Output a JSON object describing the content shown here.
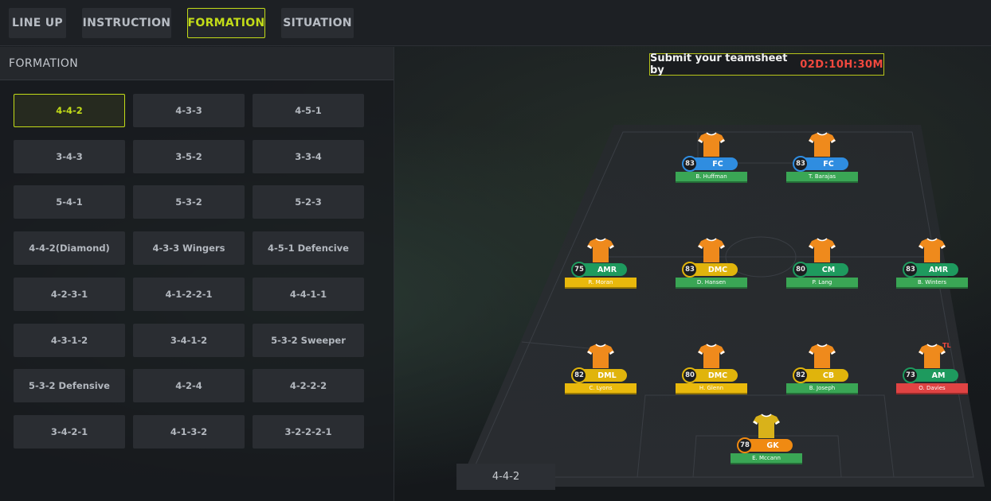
{
  "tabs": [
    {
      "label": "LINE UP",
      "active": false
    },
    {
      "label": "INSTRUCTION",
      "active": false
    },
    {
      "label": "FORMATION",
      "active": true
    },
    {
      "label": "SITUATION",
      "active": false
    }
  ],
  "formation_panel": {
    "title": "FORMATION",
    "options": [
      "4-4-2",
      "4-3-3",
      "4-5-1",
      "3-4-3",
      "3-5-2",
      "3-3-4",
      "5-4-1",
      "5-3-2",
      "5-2-3",
      "4-4-2(Diamond)",
      "4-3-3 Wingers",
      "4-5-1 Defencive",
      "4-2-3-1",
      "4-1-2-2-1",
      "4-4-1-1",
      "4-3-1-2",
      "3-4-1-2",
      "5-3-2 Sweeper",
      "5-3-2 Defensive",
      "4-2-4",
      "4-2-2-2",
      "3-4-2-1",
      "4-1-3-2",
      "3-2-2-2-1"
    ],
    "selected": "4-4-2"
  },
  "deadline": {
    "label": "Submit your teamsheet by",
    "countdown": "02D:10H:30M"
  },
  "pitch": {
    "formation_label": "4-4-2",
    "players": [
      {
        "name": "B. Huffman",
        "pos": "FC",
        "rating": "83",
        "bar_color": "#2f8de0",
        "ring_color": "#2f8de0",
        "name_color": "#3aa655",
        "shirt": "orange"
      },
      {
        "name": "T. Barajas",
        "pos": "FC",
        "rating": "83",
        "bar_color": "#2f8de0",
        "ring_color": "#2f8de0",
        "name_color": "#3aa655",
        "shirt": "orange"
      },
      {
        "name": "R. Moran",
        "pos": "AMR",
        "rating": "75",
        "bar_color": "#1e9a5e",
        "ring_color": "#1e9a5e",
        "name_color": "#e9b90c",
        "shirt": "orange"
      },
      {
        "name": "D. Hansen",
        "pos": "DMC",
        "rating": "83",
        "bar_color": "#e0b40c",
        "ring_color": "#e0b40c",
        "name_color": "#3aa655",
        "shirt": "orange"
      },
      {
        "name": "P. Lang",
        "pos": "CM",
        "rating": "80",
        "bar_color": "#1e9a5e",
        "ring_color": "#1e9a5e",
        "name_color": "#3aa655",
        "shirt": "orange"
      },
      {
        "name": "B. Winters",
        "pos": "AMR",
        "rating": "83",
        "bar_color": "#1e9a5e",
        "ring_color": "#1e9a5e",
        "name_color": "#3aa655",
        "shirt": "orange"
      },
      {
        "name": "C. Lyons",
        "pos": "DML",
        "rating": "82",
        "bar_color": "#e0b40c",
        "ring_color": "#e0b40c",
        "name_color": "#e9b90c",
        "shirt": "orange"
      },
      {
        "name": "H. Glenn",
        "pos": "DMC",
        "rating": "80",
        "bar_color": "#e0b40c",
        "ring_color": "#e0b40c",
        "name_color": "#e9b90c",
        "shirt": "orange"
      },
      {
        "name": "B. Joseph",
        "pos": "CB",
        "rating": "82",
        "bar_color": "#e0b40c",
        "ring_color": "#e0b40c",
        "name_color": "#3aa655",
        "shirt": "orange"
      },
      {
        "name": "O. Davies",
        "pos": "AM",
        "rating": "73",
        "bar_color": "#1e9a5e",
        "ring_color": "#1e9a5e",
        "name_color": "#e04343",
        "shirt": "orange",
        "tag": "TL"
      },
      {
        "name": "E. Mccann",
        "pos": "GK",
        "rating": "78",
        "bar_color": "#f08a12",
        "ring_color": "#f08a12",
        "name_color": "#3aa655",
        "shirt": "yellow"
      }
    ]
  }
}
